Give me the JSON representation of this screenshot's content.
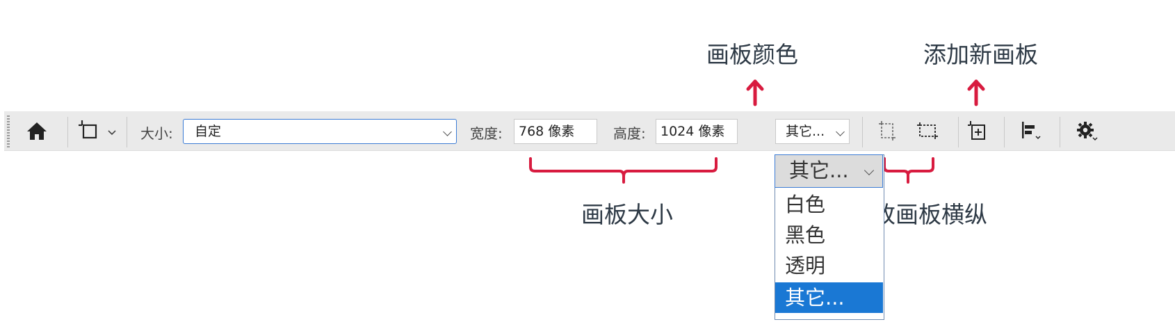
{
  "annotations": {
    "artboard_color": "画板颜色",
    "add_artboard": "添加新画板",
    "artboard_size": "画板大小",
    "orientation": "更改画板横纵"
  },
  "toolbar": {
    "size_label": "大小:",
    "size_value": "自定",
    "width_label": "宽度:",
    "width_value": "768 像素",
    "height_label": "高度:",
    "height_value": "1024 像素",
    "color_select_value": "其它..."
  },
  "dropdown": {
    "current": "其它...",
    "options": [
      "白色",
      "黑色",
      "透明",
      "其它..."
    ],
    "selected_index": 3
  },
  "icons": [
    "home-icon",
    "artboard-tool-icon",
    "portrait-icon",
    "landscape-icon",
    "add-artboard-icon",
    "align-icon",
    "gear-icon"
  ],
  "colors": {
    "accent": "#d81b3f",
    "selection": "#1a78d4",
    "toolbar_bg": "#eaeaea"
  }
}
